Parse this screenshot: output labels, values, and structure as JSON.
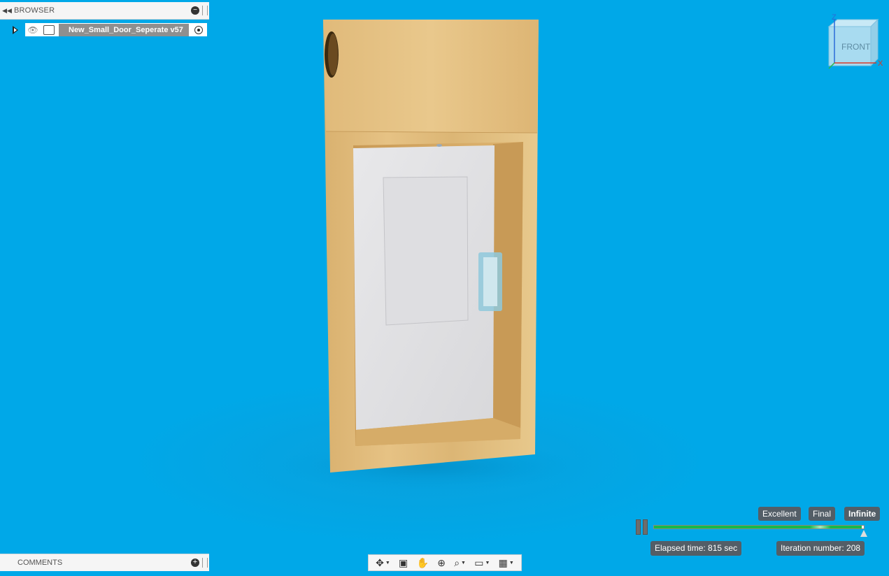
{
  "browser": {
    "title": "BROWSER",
    "item_label": "New_Small_Door_Seperate v57"
  },
  "comments": {
    "title": "COMMENTS"
  },
  "viewcube": {
    "face": "FRONT",
    "axis_z": "Z",
    "axis_x": "X"
  },
  "render": {
    "quality": [
      "Excellent",
      "Final",
      "Infinite"
    ],
    "elapsed": "Elapsed time: 815 sec",
    "iteration": "Iteration number: 208",
    "progress_fraction": 0.99
  },
  "nav_toolbar": {
    "tools": [
      "orbit-icon",
      "look-at-icon",
      "pan-icon",
      "zoom-icon",
      "fit-icon",
      "display-settings-icon",
      "grid-icon"
    ]
  }
}
